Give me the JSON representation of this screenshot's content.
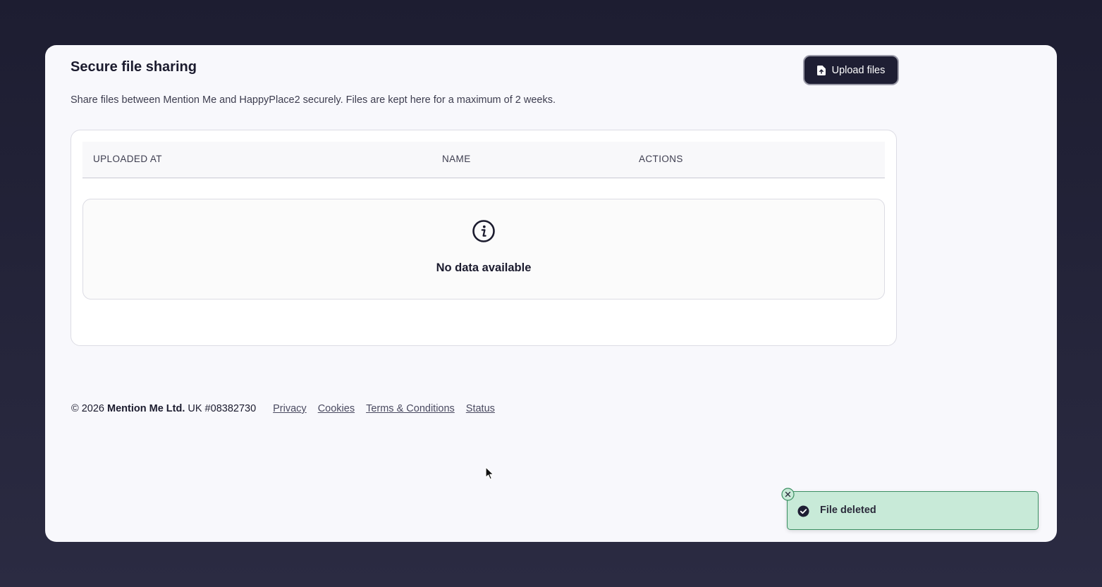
{
  "page": {
    "title": "Secure file sharing",
    "subtitle": "Share files between Mention Me and HappyPlace2 securely. Files are kept here for a maximum of 2 weeks."
  },
  "toolbar": {
    "upload_label": "Upload files",
    "upload_icon": "file-upload-icon"
  },
  "table": {
    "columns": [
      "Uploaded at",
      "Name",
      "Actions"
    ],
    "empty_icon": "info-icon",
    "empty_message": "No data available"
  },
  "footer": {
    "copyright": "© 2026",
    "company": "Mention Me Ltd.",
    "registration": "UK #08382730",
    "links": [
      "Privacy",
      "Cookies",
      "Terms & Conditions",
      "Status"
    ]
  },
  "toast": {
    "message": "File deleted",
    "icon": "check-circle-icon",
    "close_icon": "close-icon"
  },
  "colors": {
    "background": "#1d1d31",
    "panel": "#f8f8fc",
    "primary_button": "#1e1e33",
    "toast_background": "#c8ead8",
    "toast_border": "#3b8f62"
  }
}
